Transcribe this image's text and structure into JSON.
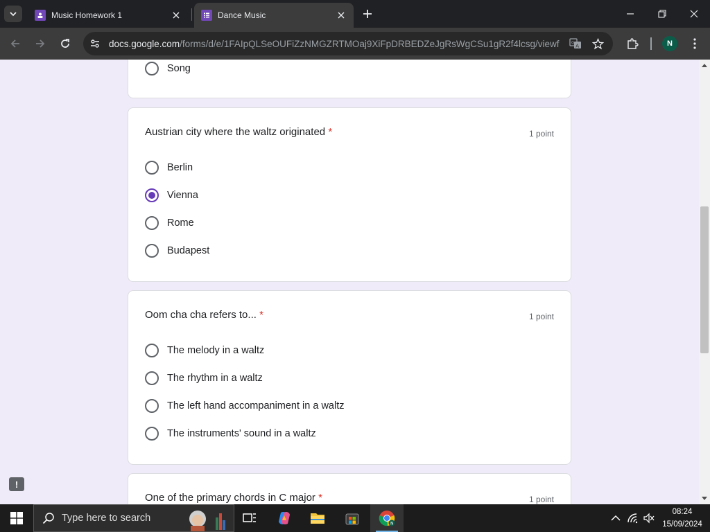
{
  "browser": {
    "tabs": [
      {
        "title": "Music Homework 1",
        "active": false,
        "favicon": "google-classroom-icon"
      },
      {
        "title": "Dance Music",
        "active": true,
        "favicon": "google-forms-icon"
      }
    ],
    "url_domain": "docs.google.com",
    "url_path": "/forms/d/e/1FAIpQLSeOUFiZzNMGZRTMOaj9XiFpDRBEDZeJgRsWgCSu1gR2f4lcsg/viewf...",
    "profile_initial": "N",
    "accent_color": "#673ab7"
  },
  "form": {
    "prev_question_last_option": "Song",
    "questions": [
      {
        "title": "Austrian city where the waltz originated",
        "required_mark": "*",
        "points": "1 point",
        "options": [
          "Berlin",
          "Vienna",
          "Rome",
          "Budapest"
        ],
        "selected": "Vienna"
      },
      {
        "title": "Oom cha cha refers to...",
        "required_mark": "*",
        "points": "1 point",
        "options": [
          "The melody in a waltz",
          "The rhythm in a waltz",
          "The left hand accompaniment in a waltz",
          "The instruments' sound in a waltz"
        ],
        "selected": null
      },
      {
        "title": "One of the primary chords in C major",
        "required_mark": "*",
        "points": "1 point"
      }
    ],
    "report_button": "!"
  },
  "taskbar": {
    "search_placeholder": "Type here to search",
    "time": "08:24",
    "date": "15/09/2024"
  }
}
